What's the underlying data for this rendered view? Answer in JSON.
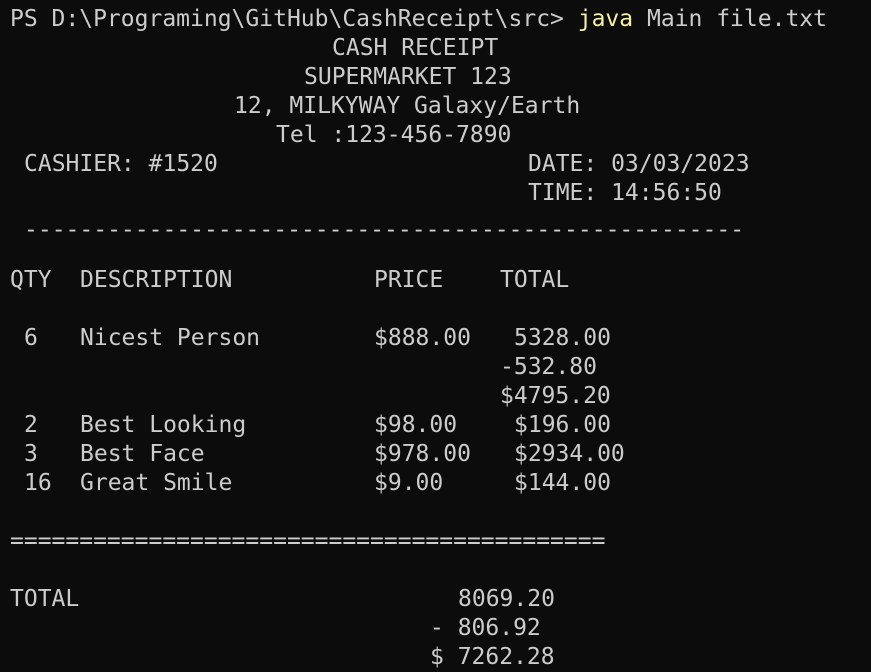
{
  "terminal": {
    "prompt": "PS D:\\Programing\\GitHub\\CashReceipt\\src> ",
    "command": "java",
    "args": " Main file.txt",
    "colors": {
      "background": "#0c0c0c",
      "foreground": "#cccccc",
      "command": "#f9f1a5"
    }
  },
  "receipt": {
    "title": "CASH RECEIPT",
    "store": "SUPERMARKET 123",
    "address": "12, MILKYWAY Galaxy/Earth",
    "tel": "Tel :123-456-7890",
    "cashier": "CASHIER: #1520",
    "date": "DATE: 03/03/2023",
    "time": "TIME: 14:56:50",
    "separator": "----------------------------------------------------",
    "headers": {
      "qty": "QTY",
      "description": "DESCRIPTION",
      "price": "PRICE",
      "total": "TOTAL"
    },
    "items": [
      {
        "qty": "6",
        "description": "Nicest Person",
        "price": "$888.00",
        "total": "5328.00"
      },
      {
        "qty": "2",
        "description": "Best Looking",
        "price": "$98.00",
        "total": "$196.00"
      },
      {
        "qty": "3",
        "description": "Best Face",
        "price": "$978.00",
        "total": "$2934.00"
      },
      {
        "qty": "16",
        "description": "Great Smile",
        "price": "$9.00",
        "total": "$144.00"
      }
    ],
    "item_discount": "-532.80",
    "item_after_discount": "$4795.20",
    "double_separator": "===========================================",
    "total_label": "TOTAL",
    "total_value": "8069.20",
    "total_discount": "- 806.92",
    "total_final": "$ 7262.28"
  }
}
